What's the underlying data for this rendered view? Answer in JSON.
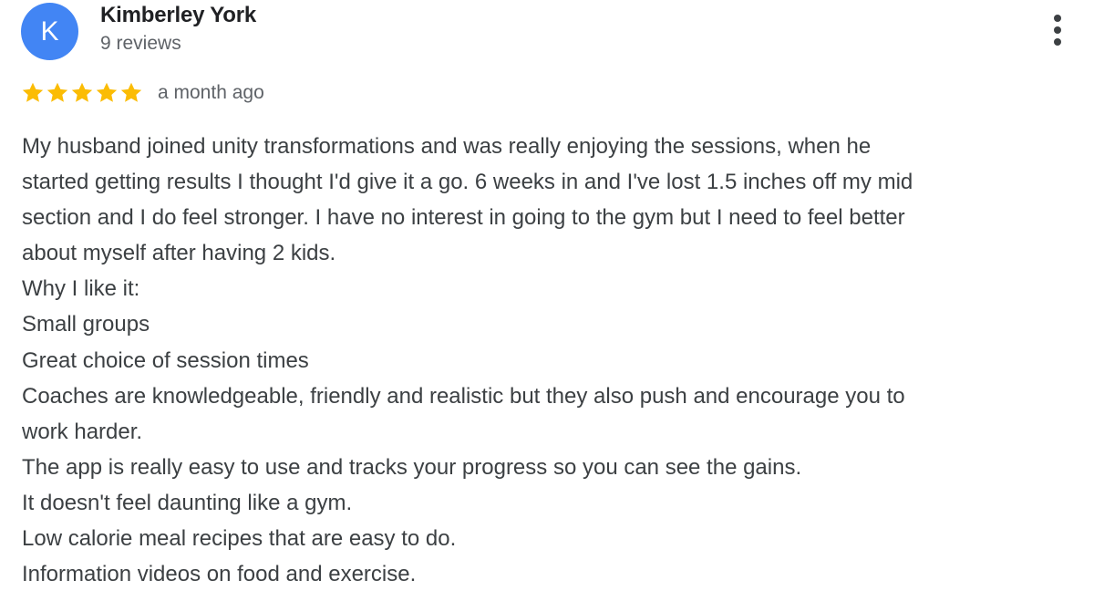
{
  "reviewer": {
    "initial": "K",
    "name": "Kimberley York",
    "review_count": "9 reviews",
    "avatar_color": "#4285f4"
  },
  "rating": {
    "stars": 5,
    "max_stars": 5,
    "star_color": "#fbbc04",
    "date": "a month ago"
  },
  "menu": {
    "icon": "more-vert-icon"
  },
  "review": {
    "lines": [
      "My husband joined unity transformations and was really enjoying the sessions, when he",
      "started getting results I thought I'd give it a go. 6 weeks in and I've lost 1.5 inches off my mid",
      "section and I do feel stronger. I have no interest in going to the gym but I need to feel better",
      "about myself after having 2 kids.",
      "Why I like it:",
      "Small groups",
      "Great choice of session times",
      "Coaches are knowledgeable, friendly and realistic but they also push and encourage you to",
      "work harder.",
      "The app is really easy to use and tracks your progress so you can see the gains.",
      "It doesn't feel daunting like a gym.",
      "Low calorie meal recipes that are easy to do.",
      "Information videos on food and exercise."
    ]
  }
}
